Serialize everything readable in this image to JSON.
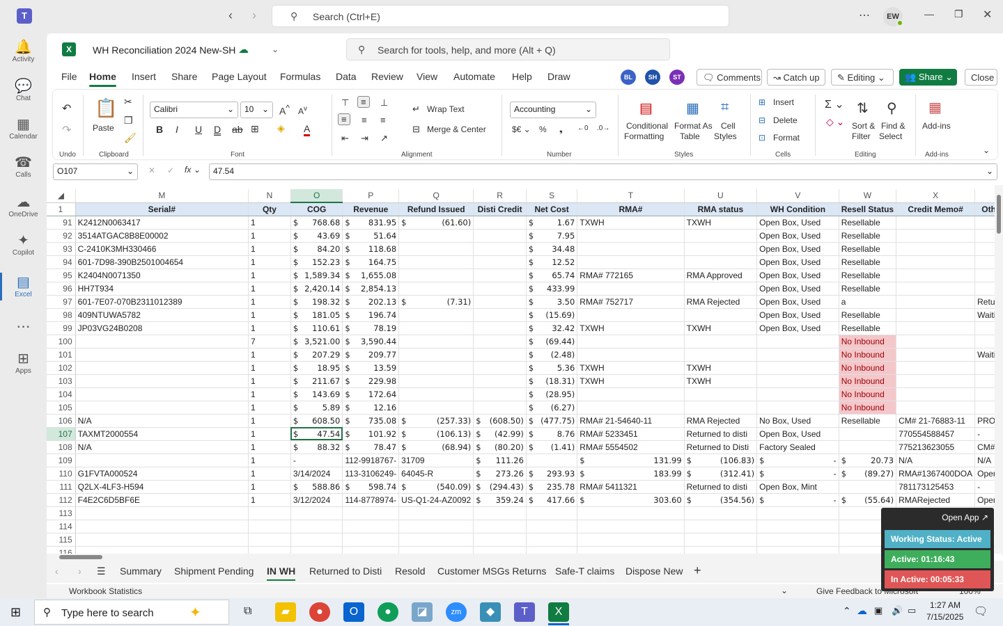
{
  "titlebar": {
    "search_placeholder": "Search (Ctrl+E)",
    "avatar": "EW"
  },
  "rail": [
    {
      "label": "Activity",
      "icon": "bell-icon",
      "glyph": "🔔"
    },
    {
      "label": "Chat",
      "icon": "chat-icon",
      "glyph": "💬"
    },
    {
      "label": "Calendar",
      "icon": "calendar-icon",
      "glyph": "▦"
    },
    {
      "label": "Calls",
      "icon": "phone-icon",
      "glyph": "☎"
    },
    {
      "label": "OneDrive",
      "icon": "cloud-icon",
      "glyph": "☁"
    },
    {
      "label": "Copilot",
      "icon": "copilot-icon",
      "glyph": "✦"
    },
    {
      "label": "Excel",
      "icon": "excel-icon",
      "glyph": "▤"
    },
    {
      "label": "",
      "icon": "more-icon",
      "glyph": "⋯"
    },
    {
      "label": "Apps",
      "icon": "apps-icon",
      "glyph": "⊞"
    }
  ],
  "workbook": {
    "title": "WH Reconciliation 2024 New-SH",
    "search_placeholder": "Search for tools, help, and more (Alt + Q)"
  },
  "menu": [
    "File",
    "Home",
    "Insert",
    "Share",
    "Page Layout",
    "Formulas",
    "Data",
    "Review",
    "View",
    "Automate",
    "Help",
    "Draw"
  ],
  "collab": [
    {
      "initials": "BL",
      "color": "#3a62c9"
    },
    {
      "initials": "SH",
      "color": "#1f52a8"
    },
    {
      "initials": "ST",
      "color": "#7b2fb5"
    }
  ],
  "actions": {
    "comments": "Comments",
    "catchup": "Catch up",
    "editing": "Editing",
    "share": "Share",
    "close": "Close"
  },
  "ribbon": {
    "undo": "Undo",
    "paste": "Paste",
    "clipboard": "Clipboard",
    "font_name": "Calibri",
    "font_size": "10",
    "font": "Font",
    "wrap": "Wrap Text",
    "merge": "Merge & Center",
    "alignment": "Alignment",
    "numfmt": "Accounting",
    "number": "Number",
    "cond": "Conditional",
    "cond2": "Formatting",
    "fmt_table": "Format As",
    "fmt_table2": "Table",
    "cell_styles": "Cell",
    "cell_styles2": "Styles",
    "styles": "Styles",
    "insert": "Insert",
    "delete": "Delete",
    "format": "Format",
    "cells": "Cells",
    "sort": "Sort &",
    "sort2": "Filter",
    "find": "Find &",
    "find2": "Select",
    "editing": "Editing",
    "addins": "Add-ins",
    "addins_grp": "Add-ins"
  },
  "formula": {
    "namebox": "O107",
    "value": "47.54"
  },
  "columns": [
    "M",
    "N",
    "O",
    "P",
    "Q",
    "R",
    "S",
    "T",
    "U",
    "V",
    "W",
    "X",
    ""
  ],
  "header": [
    "Serial#",
    "Qty",
    "COG",
    "Revenue",
    "Refund Issued",
    "Disti Credit",
    "Net Cost",
    "RMA#",
    "RMA status",
    "WH Condition",
    "Resell Status",
    "Credit Memo#",
    "Oth"
  ],
  "rows": [
    {
      "n": "91",
      "c": [
        "K2412N0063417",
        "1",
        "$|768.68",
        "$|831.95",
        "$|(61.60)",
        "",
        "$|1.67",
        "TXWH",
        "TXWH",
        "Open Box, Used",
        "Resellable",
        "",
        ""
      ]
    },
    {
      "n": "92",
      "c": [
        "3514ATGAC8B8E00002",
        "1",
        "$|43.69",
        "$|51.64",
        "",
        "",
        "$|7.95",
        "",
        "",
        "Open Box, Used",
        "Resellable",
        "",
        ""
      ]
    },
    {
      "n": "93",
      "c": [
        "C-2410K3MH330466",
        "1",
        "$|84.20",
        "$|118.68",
        "",
        "",
        "$|34.48",
        "",
        "",
        "Open Box, Used",
        "Resellable",
        "",
        ""
      ]
    },
    {
      "n": "94",
      "c": [
        "601-7D98-390B2501004654",
        "1",
        "$|152.23",
        "$|164.75",
        "",
        "",
        "$|12.52",
        "",
        "",
        "Open Box, Used",
        "Resellable",
        "",
        ""
      ]
    },
    {
      "n": "95",
      "c": [
        "K2404N0071350",
        "1",
        "$|1,589.34",
        "$|1,655.08",
        "",
        "",
        "$|65.74",
        "RMA# 772165",
        "RMA Approved",
        "Open Box, Used",
        "Resellable",
        "",
        ""
      ]
    },
    {
      "n": "96",
      "c": [
        "HH7T934",
        "1",
        "$|2,420.14",
        "$|2,854.13",
        "",
        "",
        "$|433.99",
        "",
        "",
        "Open Box, Used",
        "Resellable",
        "",
        ""
      ]
    },
    {
      "n": "97",
      "c": [
        "601-7E07-070B2311012389",
        "1",
        "$|198.32",
        "$|202.13",
        "$|(7.31)",
        "",
        "$|3.50",
        "RMA# 752717",
        "RMA Rejected",
        "Open Box, Used",
        "a",
        "",
        "Retur"
      ]
    },
    {
      "n": "98",
      "c": [
        "409NTUWA5782",
        "1",
        "$|181.05",
        "$|196.74",
        "",
        "",
        "$|(15.69)",
        "",
        "",
        "Open Box, Used",
        "Resellable",
        "",
        "Waiti"
      ]
    },
    {
      "n": "99",
      "c": [
        "JP03VG24B0208",
        "1",
        "$|110.61",
        "$|78.19",
        "",
        "",
        "$|32.42",
        "TXWH",
        "TXWH",
        "Open Box, Used",
        "Resellable",
        "",
        ""
      ]
    },
    {
      "n": "100",
      "c": [
        "",
        "7",
        "$|3,521.00",
        "$|3,590.44",
        "",
        "",
        "$|(69.44)",
        "",
        "",
        "",
        "No Inbound",
        "",
        ""
      ]
    },
    {
      "n": "101",
      "c": [
        "",
        "1",
        "$|207.29",
        "$|209.77",
        "",
        "",
        "$|(2.48)",
        "",
        "",
        "",
        "No Inbound",
        "",
        "Waiti"
      ]
    },
    {
      "n": "102",
      "c": [
        "",
        "1",
        "$|18.95",
        "$|13.59",
        "",
        "",
        "$|5.36",
        "TXWH",
        "TXWH",
        "",
        "No Inbound",
        "",
        ""
      ]
    },
    {
      "n": "103",
      "c": [
        "",
        "1",
        "$|211.67",
        "$|229.98",
        "",
        "",
        "$|(18.31)",
        "TXWH",
        "TXWH",
        "",
        "No Inbound",
        "",
        ""
      ]
    },
    {
      "n": "104",
      "c": [
        "",
        "1",
        "$|143.69",
        "$|172.64",
        "",
        "",
        "$|(28.95)",
        "",
        "",
        "",
        "No Inbound",
        "",
        ""
      ]
    },
    {
      "n": "105",
      "c": [
        "",
        "1",
        "$|5.89",
        "$|12.16",
        "",
        "",
        "$|(6.27)",
        "",
        "",
        "",
        "No Inbound",
        "",
        ""
      ]
    },
    {
      "n": "106",
      "c": [
        "N/A",
        "1",
        "$|608.50",
        "$|735.08",
        "$|(257.33)",
        "$|(608.50)",
        "$|(477.75)",
        "RMA# 21-54640-11",
        "RMA Rejected",
        "No Box, Used",
        "Resellable",
        "CM# 21-76883-11",
        "PRO"
      ]
    },
    {
      "n": "107",
      "c": [
        "TAXMT2000554",
        "1",
        "$|47.54",
        "$|101.92",
        "$|(106.13)",
        "$|(42.99)",
        "$|8.76",
        "RMA# 5233451",
        "Returned to disti",
        "Open Box, Used",
        "",
        "770554588457",
        "-"
      ]
    },
    {
      "n": "108",
      "c": [
        "N/A",
        "1",
        "$|88.32",
        "$|78.47",
        "$|(68.94)",
        "$|(80.20)",
        "$|(1.41)",
        "RMA# 5554502",
        "Returned to Disti",
        "Factory Sealed",
        "",
        "775213623055",
        "CM#"
      ]
    },
    {
      "n": "109",
      "c": [
        "",
        "1",
        "-",
        "112-9918767-",
        "31709",
        "$|111.26",
        "",
        "$|131.99",
        "$|(106.83)",
        "$|-",
        "$|20.73",
        "N/A",
        "N/A"
      ]
    },
    {
      "n": "110",
      "c": [
        "G1FVTA000524",
        "1",
        "3/14/2024",
        "113-3106249-",
        "64045-R",
        "$|273.26",
        "$|293.93",
        "$|183.99",
        "$|(312.41)",
        "$|-",
        "$|(89.27)",
        "RMA#1367400DOA",
        "Open"
      ]
    },
    {
      "n": "111",
      "c": [
        "Q2LX-4LF3-H594",
        "1",
        "$|588.86",
        "$|598.74",
        "$|(540.09)",
        "$|(294.43)",
        "$|235.78",
        "RMA# 5411321",
        "Returned to disti",
        "Open Box, Mint",
        "",
        "781173125453",
        "-"
      ]
    },
    {
      "n": "112",
      "c": [
        "F4E2C6D5BF6E",
        "1",
        "3/12/2024",
        "114-8778974-",
        "US-Q1-24-AZ0092",
        "$|359.24",
        "$|417.66",
        "$|303.60",
        "$|(354.56)",
        "$|-",
        "$|(55.64)",
        "RMARejected",
        "Open"
      ]
    },
    {
      "n": "113",
      "c": [
        "",
        "",
        "",
        "",
        "",
        "",
        "",
        "",
        "",
        "",
        "",
        "",
        ""
      ]
    },
    {
      "n": "114",
      "c": [
        "",
        "",
        "",
        "",
        "",
        "",
        "",
        "",
        "",
        "",
        "",
        "",
        ""
      ]
    },
    {
      "n": "115",
      "c": [
        "",
        "",
        "",
        "",
        "",
        "",
        "",
        "",
        "",
        "",
        "",
        "",
        ""
      ]
    },
    {
      "n": "116",
      "c": [
        "",
        "",
        "",
        "",
        "",
        "",
        "",
        "",
        "",
        "",
        "",
        "",
        ""
      ]
    }
  ],
  "sheets": [
    "Summary",
    "Shipment Pending",
    "IN WH",
    "Returned to Disti",
    "Resold",
    "Customer MSGs Returns",
    "Safe-T claims",
    "Dispose New"
  ],
  "status": {
    "left": "Workbook Statistics",
    "feedback": "Give Feedback to Microsoft",
    "zoom": "100%"
  },
  "timer": {
    "open": "Open App",
    "status": "Working Status: Active",
    "active": "Active: 01:16:43",
    "inactive": "In Active: 00:05:33"
  },
  "taskbar": {
    "search": "Type here to search",
    "time": "1:27 AM",
    "date": "7/15/2025"
  }
}
